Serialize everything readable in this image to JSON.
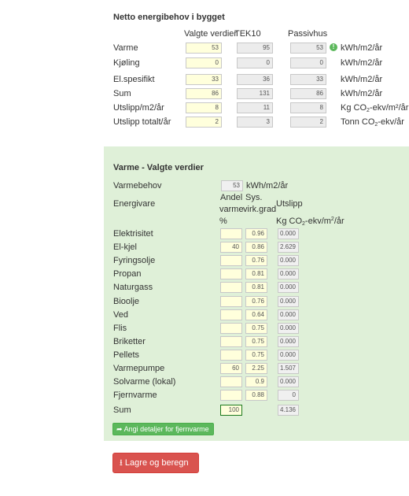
{
  "net_energy": {
    "title": "Netto energibehov i bygget",
    "col_selected": "Valgte verdier",
    "col_tek10": "TEK10",
    "col_passive": "Passivhus",
    "info_icon": "info-icon",
    "rows": [
      {
        "label": "Varme",
        "selected": "53",
        "tek10": "95",
        "passive": "53",
        "unit": "kWh/m2/år"
      },
      {
        "label": "Kjøling",
        "selected": "0",
        "tek10": "0",
        "passive": "0",
        "unit": "kWh/m2/år"
      },
      {
        "label": "El.spesifikt",
        "selected": "33",
        "tek10": "36",
        "passive": "33",
        "unit": "kWh/m2/år"
      },
      {
        "label": "Sum",
        "selected": "86",
        "tek10": "131",
        "passive": "86",
        "unit": "kWh/m2/år"
      },
      {
        "label": "Utslipp/m2/år",
        "selected": "8",
        "tek10": "11",
        "passive": "8",
        "unit_main": "Kg CO",
        "unit_sub": "2",
        "unit_tail": "-ekv/m²/år"
      },
      {
        "label": "Utslipp totalt/år",
        "selected": "2",
        "tek10": "3",
        "passive": "2",
        "unit_main": "Tonn CO",
        "unit_sub": "2",
        "unit_tail": "-ekv/år"
      }
    ]
  },
  "heat": {
    "title": "Varme - Valgte verdier",
    "demand_label": "Varmebehov",
    "demand_value": "53",
    "demand_unit": "kWh/m2/år",
    "carrier_label": "Energivare",
    "col_share_1": "Andel",
    "col_share_2": "varme",
    "col_share_3": "%",
    "col_eff_1": "Sys.",
    "col_eff_2": "virk.grad",
    "col_emis_1": "Utslipp",
    "col_emis_main": "Kg CO",
    "col_emis_sub": "2",
    "col_emis_tail": "-ekv/m",
    "col_emis_sup": "2",
    "col_emis_end": "/år",
    "rows": [
      {
        "label": "Elektrisitet",
        "share": "",
        "eff": "0.96",
        "emis": "0.000"
      },
      {
        "label": "El-kjel",
        "share": "40",
        "eff": "0.86",
        "emis": "2.629"
      },
      {
        "label": "Fyringsolje",
        "share": "",
        "eff": "0.76",
        "emis": "0.000"
      },
      {
        "label": "Propan",
        "share": "",
        "eff": "0.81",
        "emis": "0.000"
      },
      {
        "label": "Naturgass",
        "share": "",
        "eff": "0.81",
        "emis": "0.000"
      },
      {
        "label": "Bioolje",
        "share": "",
        "eff": "0.76",
        "emis": "0.000"
      },
      {
        "label": "Ved",
        "share": "",
        "eff": "0.64",
        "emis": "0.000"
      },
      {
        "label": "Flis",
        "share": "",
        "eff": "0.75",
        "emis": "0.000"
      },
      {
        "label": "Briketter",
        "share": "",
        "eff": "0.75",
        "emis": "0.000"
      },
      {
        "label": "Pellets",
        "share": "",
        "eff": "0.75",
        "emis": "0.000"
      },
      {
        "label": "Varmepumpe",
        "share": "60",
        "eff": "2.25",
        "emis": "1.507"
      },
      {
        "label": "Solvarme (lokal)",
        "share": "",
        "eff": "0.9",
        "emis": "0.000"
      },
      {
        "label": "Fjernvarme",
        "share": "",
        "eff": "0.88",
        "emis": "0"
      }
    ],
    "sum_label": "Sum",
    "sum_share": "100",
    "sum_emis": "4.136",
    "detail_button": "Angi detaljer for fjernvarme",
    "detail_icon": "share-arrow-icon"
  },
  "save_button": "Lagre og beregn",
  "save_icon": "download-icon"
}
